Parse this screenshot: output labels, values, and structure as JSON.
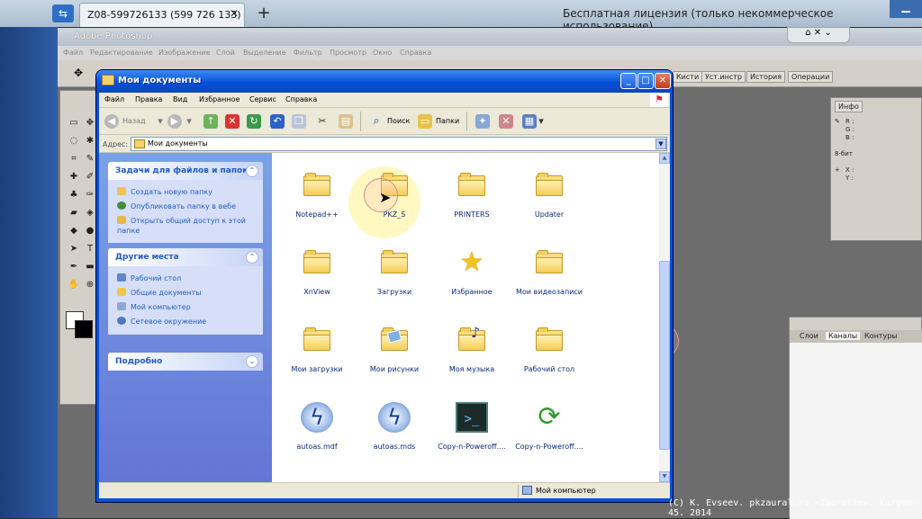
{
  "teamviewer": {
    "tab_label": "Z08-599726133 (599 726 133)",
    "tab_close": "✕",
    "new_tab": "+",
    "license": "Бесплатная лицензия (только некоммерческое использование)"
  },
  "photoshop": {
    "title": "Adobe Photoshop",
    "menus": [
      "Файл",
      "Редактирование",
      "Изображение",
      "Слой",
      "Выделение",
      "Фильтр",
      "Просмотр",
      "Окно",
      "Справка"
    ],
    "palette_tabs": [
      "Кисти",
      "Уст.инстр",
      "История",
      "Операции"
    ],
    "info_tab": "Инфо",
    "info_lines": [
      "R :",
      "G :",
      "B :",
      "8-бит",
      "X :",
      "Y :"
    ],
    "layers_tabs": [
      "Слои",
      "Каналы",
      "Контуры"
    ]
  },
  "explorer": {
    "title": "Мои документы",
    "menus": [
      "Файл",
      "Правка",
      "Вид",
      "Избранное",
      "Сервис",
      "Справка"
    ],
    "toolbar": {
      "back": "Назад",
      "search": "Поиск",
      "folders": "Папки"
    },
    "address_label": "Адрес:",
    "address_value": "Мои документы",
    "tasks": {
      "title": "Задачи для файлов и папок",
      "items": [
        "Создать новую папку",
        "Опубликовать папку в вебе",
        "Открыть общий доступ к этой папке"
      ]
    },
    "places": {
      "title": "Другие места",
      "items": [
        "Рабочий стол",
        "Общие документы",
        "Мой компьютер",
        "Сетевое окружение"
      ]
    },
    "details": {
      "title": "Подробно"
    },
    "files": [
      {
        "name": "Notepad++",
        "icon": "folder-icon"
      },
      {
        "name": "PKZ_S",
        "icon": "folder-icon"
      },
      {
        "name": "PRINTERS",
        "icon": "folder-icon"
      },
      {
        "name": "Updater",
        "icon": "folder-icon"
      },
      {
        "name": "XnView",
        "icon": "folder-icon"
      },
      {
        "name": "Загрузки",
        "icon": "folder-icon"
      },
      {
        "name": "Избранное",
        "icon": "star-icon"
      },
      {
        "name": "Мои видеозаписи",
        "icon": "folder-icon"
      },
      {
        "name": "Мои загрузки",
        "icon": "folder-icon"
      },
      {
        "name": "Мои рисунки",
        "icon": "pictures-folder-icon"
      },
      {
        "name": "Моя музыка",
        "icon": "music-folder-icon"
      },
      {
        "name": "Рабочий стол",
        "icon": "folder-icon"
      },
      {
        "name": "autoas.mdf",
        "icon": "daemon-tools-icon"
      },
      {
        "name": "autoas.mds",
        "icon": "daemon-tools-icon"
      },
      {
        "name": "Copy-n-Poweroff....",
        "icon": "console-icon"
      },
      {
        "name": "Copy-n-Poweroff....",
        "icon": "recycle-arrows-icon"
      }
    ],
    "status": "Мой компьютер"
  },
  "copyright": "(C) K. Evseev. pkzaural.ru «Zauralie». Kurgan-45. 2014"
}
